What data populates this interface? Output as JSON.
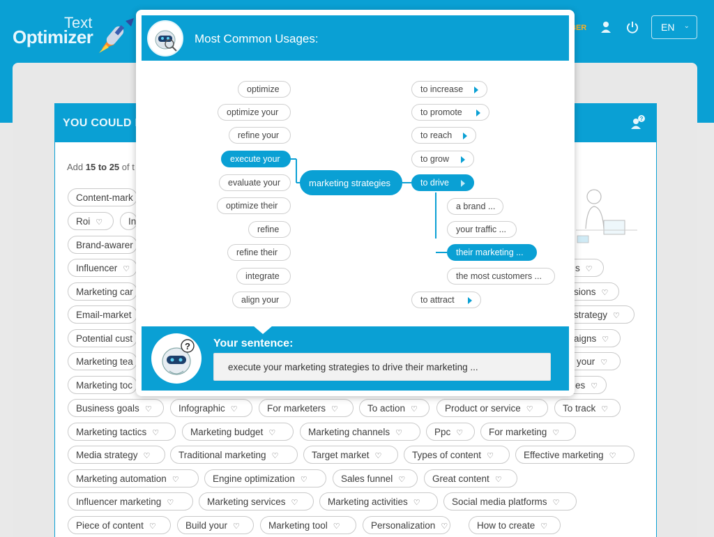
{
  "header": {
    "logo_line1": "Text",
    "logo_line2": "Optimizer",
    "member_label": "BER",
    "language": "EN"
  },
  "panel": {
    "title": "YOU COULD I",
    "add_prefix": "Add ",
    "add_range": "15 to 25",
    "add_suffix": " of t"
  },
  "tags": [
    "Content-mark",
    "Roi",
    "In",
    "Brand-awarer",
    "Influencer",
    "s",
    "Marketing car",
    "sions",
    "Email-market",
    "strategy",
    "Potential cust",
    "aigns",
    "Marketing tea",
    "your",
    "Marketing toc",
    "es",
    "Business goals",
    "Infographic",
    "For marketers",
    "To action",
    "Product or service",
    "To track",
    "Marketing tactics",
    "Marketing budget",
    "Marketing channels",
    "Ppc",
    "For marketing",
    "Media strategy",
    "Traditional marketing",
    "Target market",
    "Types of content",
    "Effective marketing",
    "Marketing automation",
    "Engine optimization",
    "Sales funnel",
    "Great content",
    "Influencer marketing",
    "Marketing services",
    "Marketing activities",
    "Social media platforms",
    "Piece of content",
    "Build your",
    "Marketing tool",
    "Personalization",
    "How to create"
  ],
  "modal": {
    "title": "Most Common Usages:",
    "left_options": [
      "optimize",
      "optimize your",
      "refine your",
      "execute your",
      "evaluate your",
      "optimize their",
      "refine",
      "refine their",
      "integrate",
      "align your"
    ],
    "center": "marketing strategies",
    "right_options": [
      "to increase",
      "to promote",
      "to reach",
      "to grow",
      "to drive",
      "to attract"
    ],
    "sub_options": [
      "a brand ...",
      "your traffic ...",
      "their marketing ...",
      "the most customers ..."
    ],
    "your_sentence_label": "Your sentence:",
    "sentence": "execute your marketing strategies to drive  their marketing ..."
  },
  "colors": {
    "accent": "#0aa0d4",
    "member": "#ffb020"
  },
  "icons": [
    "rocket-icon",
    "user-icon",
    "power-icon",
    "chevron-down-icon",
    "help-users-icon",
    "heart-icon",
    "robot-avatar-icon",
    "play-arrow-icon"
  ]
}
